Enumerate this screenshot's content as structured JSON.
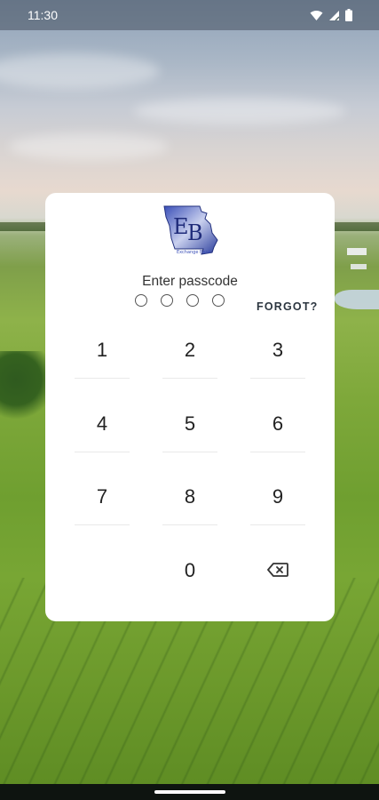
{
  "status_bar": {
    "time": "11:30",
    "icons": [
      "wifi-icon",
      "signal-icon",
      "battery-icon"
    ]
  },
  "lock_screen": {
    "logo_icon": "exchange-bank-missouri-logo",
    "logo_text": "Exchange Bank",
    "prompt": "Enter passcode",
    "passcode_length": 4,
    "entered_digits": 0,
    "forgot_label": "FORGOT?",
    "keypad": {
      "keys": [
        "1",
        "2",
        "3",
        "4",
        "5",
        "6",
        "7",
        "8",
        "9",
        "0"
      ],
      "backspace_icon": "backspace-icon"
    }
  },
  "colors": {
    "card_bg": "#ffffff",
    "text": "#222222",
    "logo_blue": "#2a3d9c"
  }
}
